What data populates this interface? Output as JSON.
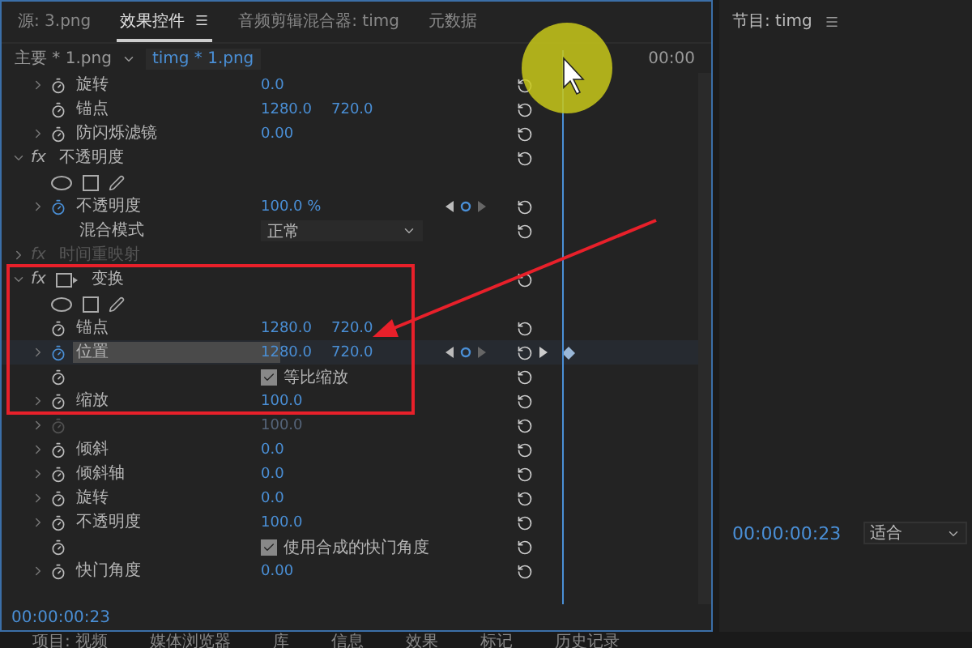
{
  "tabs": [
    {
      "label": "源: 3.png",
      "selected": false,
      "menu": false
    },
    {
      "label": "效果控件",
      "selected": true,
      "menu": true
    },
    {
      "label": "音频剪辑混合器: timg",
      "selected": false,
      "menu": false
    },
    {
      "label": "元数据",
      "selected": false,
      "menu": false
    }
  ],
  "clip_bar": {
    "master": "主要 * 1.png",
    "clip": "timg * 1.png",
    "ruler_time": "00:00"
  },
  "rows": [
    {
      "kind": "property",
      "label": "旋转",
      "values": [
        "0.0"
      ],
      "expandable": true,
      "animated": false,
      "disabled": false,
      "highlighted": false,
      "keyframe_nav": false,
      "keyframe": false
    },
    {
      "kind": "property",
      "label": "锚点",
      "values": [
        "1280.0",
        "720.0"
      ],
      "expandable": false,
      "animated": false,
      "disabled": false,
      "highlighted": false,
      "keyframe_nav": false,
      "keyframe": false
    },
    {
      "kind": "property",
      "label": "防闪烁滤镜",
      "values": [
        "0.00"
      ],
      "expandable": true,
      "animated": false,
      "disabled": false,
      "highlighted": false,
      "keyframe_nav": false,
      "keyframe": false
    },
    {
      "kind": "section",
      "badge": "fx",
      "label": "不透明度",
      "expanded": true,
      "disabled": false,
      "transform_icon": false
    },
    {
      "kind": "masks"
    },
    {
      "kind": "property",
      "label": "不透明度",
      "values": [
        "100.0 %"
      ],
      "expandable": true,
      "animated": true,
      "disabled": false,
      "highlighted": false,
      "keyframe_nav": true,
      "keyframe": false
    },
    {
      "kind": "dropdown",
      "label": "混合模式",
      "value": "正常"
    },
    {
      "kind": "section",
      "badge": "fx",
      "label": "时间重映射",
      "expanded": false,
      "disabled": true,
      "transform_icon": false
    },
    {
      "kind": "section",
      "badge": "fx",
      "label": "变换",
      "expanded": true,
      "disabled": false,
      "transform_icon": true
    },
    {
      "kind": "masks"
    },
    {
      "kind": "property",
      "label": "锚点",
      "values": [
        "1280.0",
        "720.0"
      ],
      "expandable": false,
      "animated": false,
      "disabled": false,
      "highlighted": false,
      "keyframe_nav": false,
      "keyframe": false
    },
    {
      "kind": "property",
      "label": "位置",
      "values": [
        "1280.0",
        "720.0"
      ],
      "expandable": true,
      "animated": true,
      "disabled": false,
      "highlighted": true,
      "keyframe_nav": true,
      "keyframe": true
    },
    {
      "kind": "checkbox",
      "label": "等比缩放",
      "checked": true
    },
    {
      "kind": "property",
      "label": "缩放",
      "values": [
        "100.0"
      ],
      "expandable": true,
      "animated": false,
      "disabled": false,
      "highlighted": false,
      "keyframe_nav": false,
      "keyframe": false
    },
    {
      "kind": "property",
      "values": [
        "100.0"
      ],
      "expandable": true,
      "animated": false,
      "disabled": true,
      "highlighted": false,
      "keyframe_nav": false,
      "keyframe": false
    },
    {
      "kind": "property",
      "label": "倾斜",
      "values": [
        "0.0"
      ],
      "expandable": true,
      "animated": false,
      "disabled": false,
      "highlighted": false,
      "keyframe_nav": false,
      "keyframe": false
    },
    {
      "kind": "property",
      "label": "倾斜轴",
      "values": [
        "0.0"
      ],
      "expandable": true,
      "animated": false,
      "disabled": false,
      "highlighted": false,
      "keyframe_nav": false,
      "keyframe": false
    },
    {
      "kind": "property",
      "label": "旋转",
      "values": [
        "0.0"
      ],
      "expandable": true,
      "animated": false,
      "disabled": false,
      "highlighted": false,
      "keyframe_nav": false,
      "keyframe": false
    },
    {
      "kind": "property",
      "label": "不透明度",
      "values": [
        "100.0"
      ],
      "expandable": true,
      "animated": false,
      "disabled": false,
      "highlighted": false,
      "keyframe_nav": false,
      "keyframe": false
    },
    {
      "kind": "checkbox",
      "label": "使用合成的快门角度",
      "checked": true
    },
    {
      "kind": "property",
      "label": "快门角度",
      "values": [
        "0.00"
      ],
      "expandable": true,
      "animated": false,
      "disabled": false,
      "highlighted": false,
      "keyframe_nav": false,
      "keyframe": false
    }
  ],
  "timecode": "00:00:00:23",
  "program": {
    "title": "节目: timg",
    "timecode": "00:00:00:23",
    "zoom": "适合"
  },
  "bottom_tabs": [
    "项目: 视频",
    "媒体浏览器",
    "库",
    "信息",
    "效果",
    "标记",
    "历史记录"
  ]
}
